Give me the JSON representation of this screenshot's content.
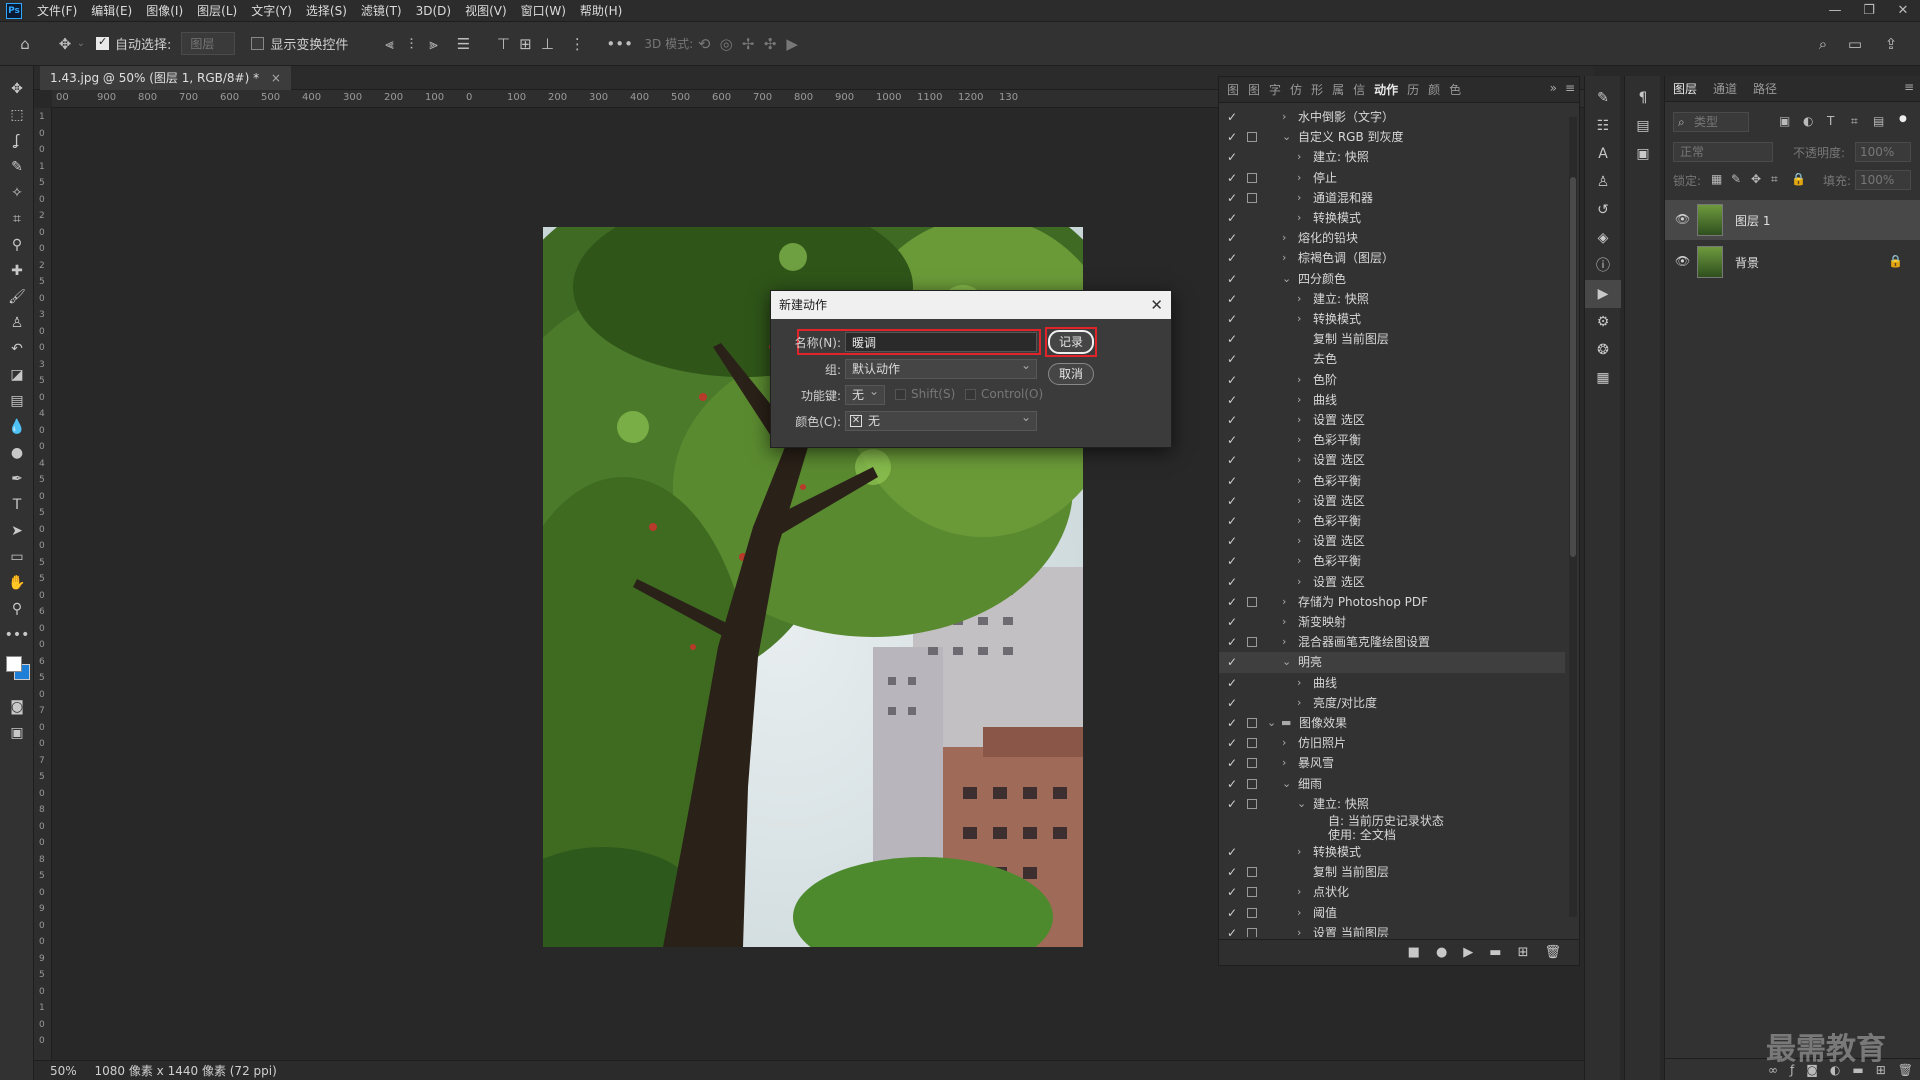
{
  "menubar": {
    "logo": "Ps",
    "items": [
      "文件(F)",
      "编辑(E)",
      "图像(I)",
      "图层(L)",
      "文字(Y)",
      "选择(S)",
      "滤镜(T)",
      "3D(D)",
      "视图(V)",
      "窗口(W)",
      "帮助(H)"
    ]
  },
  "options": {
    "auto_select_label": "自动选择:",
    "auto_select_value": "图层",
    "show_transform_label": "显示变换控件",
    "more": "•••",
    "mode_3d_label": "3D 模式:"
  },
  "document": {
    "tab_label": "1.43.jpg @ 50% (图层 1, RGB/8#) *",
    "close": "×",
    "status_zoom": "50%",
    "status_info": "1080 像素 x 1440 像素 (72 ppi)"
  },
  "ruler_top": [
    "00",
    "900",
    "800",
    "700",
    "600",
    "500",
    "400",
    "300",
    "200",
    "100",
    "0",
    "100",
    "200",
    "300",
    "400",
    "500",
    "600",
    "700",
    "800",
    "900",
    "1000",
    "1100",
    "1200",
    "130"
  ],
  "ruler_left": [
    "1",
    "0",
    "0",
    "1",
    "5",
    "0",
    "2",
    "0",
    "0",
    "2",
    "5",
    "0",
    "3",
    "0",
    "0",
    "3",
    "5",
    "0",
    "4",
    "0",
    "0",
    "4",
    "5",
    "0",
    "5",
    "0",
    "0",
    "5",
    "5",
    "0",
    "6",
    "0",
    "0",
    "6",
    "5",
    "0",
    "7",
    "0",
    "0",
    "7",
    "5",
    "0",
    "8",
    "0",
    "0",
    "8",
    "5",
    "0",
    "9",
    "0",
    "0",
    "9",
    "5",
    "0",
    "1",
    "0",
    "0"
  ],
  "dialog": {
    "title": "新建动作",
    "close": "✕",
    "name_label": "名称(N):",
    "name_value": "暖调",
    "group_label": "组:",
    "group_value": "默认动作",
    "function_key_label": "功能键:",
    "function_key_value": "无",
    "shift_label": "Shift(S)",
    "control_label": "Control(O)",
    "color_label": "颜色(C):",
    "color_value": "无",
    "record_button": "记录",
    "cancel_button": "取消"
  },
  "actions_panel": {
    "tabs": [
      "图",
      "图",
      "字",
      "仿",
      "形",
      "属",
      "信",
      "动作",
      "历",
      "颜",
      "色"
    ],
    "active_tab": "动作",
    "rows": [
      {
        "text": "水中倒影（文字）",
        "level": 1,
        "check": true,
        "toggle": false,
        "arrow": "›"
      },
      {
        "text": "自定义 RGB 到灰度",
        "level": 1,
        "check": true,
        "toggle": true,
        "arrow": "⌄"
      },
      {
        "text": "建立: 快照",
        "level": 2,
        "check": true,
        "toggle": false,
        "arrow": "›"
      },
      {
        "text": "停止",
        "level": 2,
        "check": true,
        "toggle": true,
        "arrow": "›"
      },
      {
        "text": "通道混和器",
        "level": 2,
        "check": true,
        "toggle": true,
        "arrow": "›"
      },
      {
        "text": "转换模式",
        "level": 2,
        "check": true,
        "toggle": false,
        "arrow": "›"
      },
      {
        "text": "熔化的铅块",
        "level": 1,
        "check": true,
        "toggle": false,
        "arrow": "›"
      },
      {
        "text": "棕褐色调（图层）",
        "level": 1,
        "check": true,
        "toggle": false,
        "arrow": "›"
      },
      {
        "text": "四分颜色",
        "level": 1,
        "check": true,
        "toggle": false,
        "arrow": "⌄"
      },
      {
        "text": "建立: 快照",
        "level": 2,
        "check": true,
        "toggle": false,
        "arrow": "›"
      },
      {
        "text": "转换模式",
        "level": 2,
        "check": true,
        "toggle": false,
        "arrow": "›"
      },
      {
        "text": "复制 当前图层",
        "level": 2,
        "check": true,
        "toggle": false,
        "arrow": ""
      },
      {
        "text": "去色",
        "level": 2,
        "check": true,
        "toggle": false,
        "arrow": ""
      },
      {
        "text": "色阶",
        "level": 2,
        "check": true,
        "toggle": false,
        "arrow": "›"
      },
      {
        "text": "曲线",
        "level": 2,
        "check": true,
        "toggle": false,
        "arrow": "›"
      },
      {
        "text": "设置 选区",
        "level": 2,
        "check": true,
        "toggle": false,
        "arrow": "›"
      },
      {
        "text": "色彩平衡",
        "level": 2,
        "check": true,
        "toggle": false,
        "arrow": "›"
      },
      {
        "text": "设置 选区",
        "level": 2,
        "check": true,
        "toggle": false,
        "arrow": "›"
      },
      {
        "text": "色彩平衡",
        "level": 2,
        "check": true,
        "toggle": false,
        "arrow": "›"
      },
      {
        "text": "设置 选区",
        "level": 2,
        "check": true,
        "toggle": false,
        "arrow": "›"
      },
      {
        "text": "色彩平衡",
        "level": 2,
        "check": true,
        "toggle": false,
        "arrow": "›"
      },
      {
        "text": "设置 选区",
        "level": 2,
        "check": true,
        "toggle": false,
        "arrow": "›"
      },
      {
        "text": "色彩平衡",
        "level": 2,
        "check": true,
        "toggle": false,
        "arrow": "›"
      },
      {
        "text": "设置 选区",
        "level": 2,
        "check": true,
        "toggle": false,
        "arrow": "›"
      },
      {
        "text": "存储为 Photoshop PDF",
        "level": 1,
        "check": true,
        "toggle": true,
        "arrow": "›"
      },
      {
        "text": "渐变映射",
        "level": 1,
        "check": true,
        "toggle": false,
        "arrow": "›"
      },
      {
        "text": "混合器画笔克隆绘图设置",
        "level": 1,
        "check": true,
        "toggle": true,
        "arrow": "›"
      },
      {
        "text": "明亮",
        "level": 1,
        "check": true,
        "toggle": false,
        "arrow": "⌄",
        "selected": true
      },
      {
        "text": "曲线",
        "level": 2,
        "check": true,
        "toggle": false,
        "arrow": "›"
      },
      {
        "text": "亮度/对比度",
        "level": 2,
        "check": true,
        "toggle": false,
        "arrow": "›"
      },
      {
        "text": "图像效果",
        "level": 0,
        "check": true,
        "toggle": true,
        "arrow": "⌄",
        "folder": true
      },
      {
        "text": "仿旧照片",
        "level": 1,
        "check": true,
        "toggle": true,
        "arrow": "›"
      },
      {
        "text": "暴风雪",
        "level": 1,
        "check": true,
        "toggle": true,
        "arrow": "›"
      },
      {
        "text": "细雨",
        "level": 1,
        "check": true,
        "toggle": true,
        "arrow": "⌄"
      },
      {
        "text": "建立: 快照",
        "level": 2,
        "check": true,
        "toggle": true,
        "arrow": "⌄"
      },
      {
        "text": "自: 当前历史记录状态",
        "level": 3,
        "check": false,
        "toggle": false,
        "arrow": "",
        "tight": true
      },
      {
        "text": "使用: 全文档",
        "level": 3,
        "check": false,
        "toggle": false,
        "arrow": "",
        "tight": true
      },
      {
        "text": "转换模式",
        "level": 2,
        "check": true,
        "toggle": false,
        "arrow": "›"
      },
      {
        "text": "复制 当前图层",
        "level": 2,
        "check": true,
        "toggle": true,
        "arrow": ""
      },
      {
        "text": "点状化",
        "level": 2,
        "check": true,
        "toggle": true,
        "arrow": "›"
      },
      {
        "text": "阈值",
        "level": 2,
        "check": true,
        "toggle": true,
        "arrow": "›"
      },
      {
        "text": "设置 当前图层",
        "level": 2,
        "check": true,
        "toggle": true,
        "arrow": "›"
      }
    ],
    "footer_icons": [
      "stop-icon",
      "record-icon",
      "play-icon",
      "folder-icon",
      "new-action-icon",
      "trash-icon"
    ]
  },
  "layers_panel": {
    "tabs": [
      "图层",
      "通道",
      "路径"
    ],
    "active_tab": "图层",
    "filter_placeholder": "类型",
    "blend_mode": "正常",
    "opacity_label": "不透明度:",
    "opacity_value": "100%",
    "lock_label": "锁定:",
    "fill_label": "填充:",
    "fill_value": "100%",
    "layers": [
      {
        "name": "图层 1",
        "selected": true,
        "locked": false
      },
      {
        "name": "背景",
        "selected": false,
        "locked": true
      }
    ]
  },
  "watermark": "最需教育",
  "colors": {
    "accent": "#31a8ff",
    "highlight": "#e0242a"
  }
}
